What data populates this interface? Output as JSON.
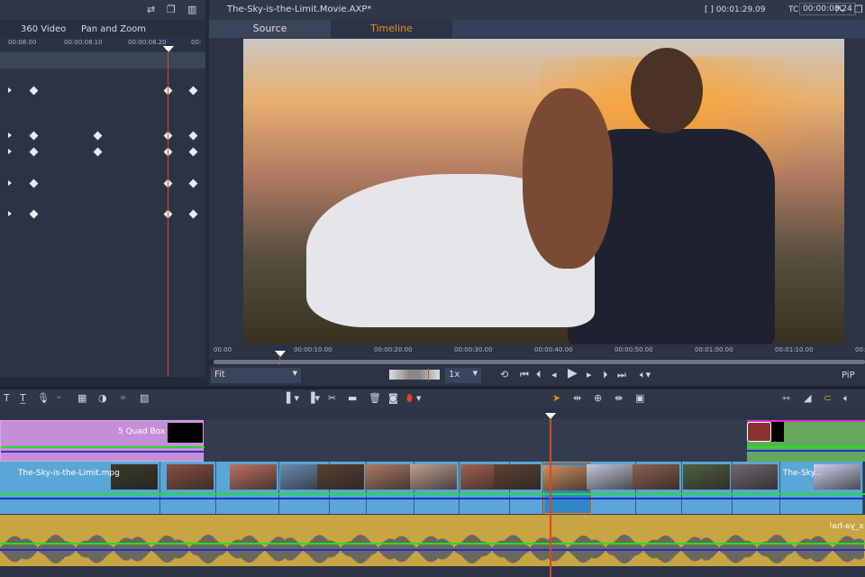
{
  "left_panel": {
    "tabs": [
      "360 Video",
      "Pan and Zoom"
    ],
    "ruler": [
      "00:08.00",
      "00:00:08.10",
      "00:00:08.20",
      "00:"
    ],
    "icons": [
      "swap-icon",
      "popout-icon",
      "layout-icon"
    ]
  },
  "player": {
    "title": "The-Sky-is-the-Limit.Movie.AXP*",
    "duration": "[ ] 00:01:29.09",
    "tc_label": "TC",
    "timecode": "00:00:08.24",
    "tabs": {
      "source": "Source",
      "timeline": "Timeline",
      "active": "Timeline"
    },
    "ruler": [
      "00.00",
      "00:00:10.00",
      "00:00:20.00",
      "00:00:30.00",
      "00:00:40.00",
      "00:00:50.00",
      "00:01:00.00",
      "00:01:10.00",
      "00:01:20.00"
    ],
    "zoom_select": "Fit",
    "speed_select": "1x",
    "pip": "PiP",
    "accent": "#f08a1c"
  },
  "timeline": {
    "overlay_clip": "5 Quad Box 1",
    "video_clip": "The-Sky-is-the-Limit.mpg",
    "video_clip_2": "The-Sky...",
    "audio_clip": "x_ya-ha!",
    "colors": {
      "title_track": "#c48fd6",
      "video_track": "#5aa6d6",
      "audio_track": "#c8a443",
      "green_clip": "#64a85a",
      "playhead": "#e0461e"
    }
  }
}
